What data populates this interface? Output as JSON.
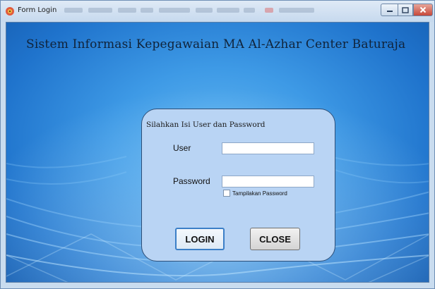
{
  "window": {
    "title": "Form Login",
    "accent_color": "#c6473a",
    "app_icon": "gear-flower-icon"
  },
  "header": {
    "app_title": "Sistem Informasi Kepegawaian MA Al-Azhar Center Baturaja"
  },
  "login_panel": {
    "prompt": "Silahkan Isi User dan Password",
    "user_label": "User",
    "user_value": "",
    "password_label": "Password",
    "password_value": "",
    "show_password_label": "Tampilakan Password",
    "show_password_checked": false,
    "login_button": "LOGIN",
    "close_button": "CLOSE"
  },
  "colors": {
    "background_top": "#5fb4f0",
    "background_edge": "#175fb2",
    "panel": "#b9d4f4"
  }
}
